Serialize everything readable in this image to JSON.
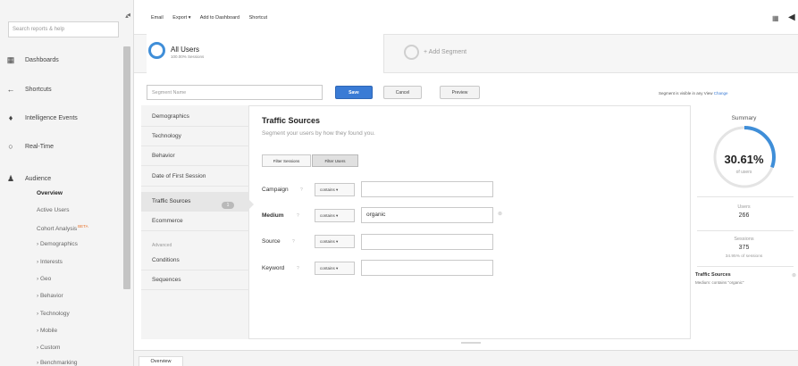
{
  "sidebar": {
    "search_placeholder": "Search reports & help",
    "nav": [
      {
        "label": "Dashboards",
        "icon": "grid-icon"
      },
      {
        "label": "Shortcuts",
        "icon": "shortcut-arrow-icon"
      },
      {
        "label": "Intelligence Events",
        "icon": "lightbulb-icon"
      },
      {
        "label": "Real-Time",
        "icon": "clock-icon"
      },
      {
        "label": "Audience",
        "icon": "people-icon"
      }
    ],
    "audience_items": [
      {
        "label": "Overview",
        "active": true
      },
      {
        "label": "Active Users"
      },
      {
        "label": "Cohort Analysis",
        "badge": "BETA"
      },
      {
        "label": "› Demographics"
      },
      {
        "label": "› Interests"
      },
      {
        "label": "› Geo"
      },
      {
        "label": "› Behavior"
      },
      {
        "label": "› Technology"
      },
      {
        "label": "› Mobile"
      },
      {
        "label": "› Custom"
      },
      {
        "label": "› Benchmarking"
      }
    ]
  },
  "toolbar": {
    "links": [
      "Email",
      "Export ▾",
      "Add to Dashboard",
      "Shortcut"
    ]
  },
  "segments": {
    "active": {
      "title": "All Users",
      "subtitle": "100.00% Sessions"
    },
    "add_label": "+ Add Segment"
  },
  "editor": {
    "name_placeholder": "Segment Name",
    "save": "Save",
    "cancel": "Cancel",
    "preview": "Preview",
    "visibility_text": "Segment is visible in any View",
    "visibility_link": "Change",
    "categories": [
      "Demographics",
      "Technology",
      "Behavior",
      "Date of First Session",
      "Traffic Sources",
      "Ecommerce"
    ],
    "advanced_label": "Advanced",
    "advanced_items": [
      "Conditions",
      "Sequences"
    ],
    "active_badge": "1",
    "section_title": "Traffic Sources",
    "section_subtitle": "Segment your users by how they found you.",
    "filter_tabs": [
      "Filter Sessions",
      "Filter Users"
    ],
    "fields": [
      {
        "label": "Campaign",
        "operator": "contains",
        "value": ""
      },
      {
        "label": "Medium",
        "operator": "contains",
        "value": "organic"
      },
      {
        "label": "Source",
        "operator": "contains",
        "value": ""
      },
      {
        "label": "Keyword",
        "operator": "contains",
        "value": ""
      }
    ]
  },
  "summary": {
    "title": "Summary",
    "percent": "30.61%",
    "percent_value": 0.3061,
    "of_label": "of users",
    "users_label": "Users",
    "users_value": "266",
    "sessions_label": "Sessions",
    "sessions_value": "375",
    "sessions_pct": "34.95% of sessions",
    "ts_title": "Traffic Sources",
    "ts_desc": "Medium: contains \"organic\""
  },
  "bottom": {
    "tab": "Overview"
  },
  "colors": {
    "accent": "#3a7bd5",
    "ring": "#3f8ed8"
  }
}
